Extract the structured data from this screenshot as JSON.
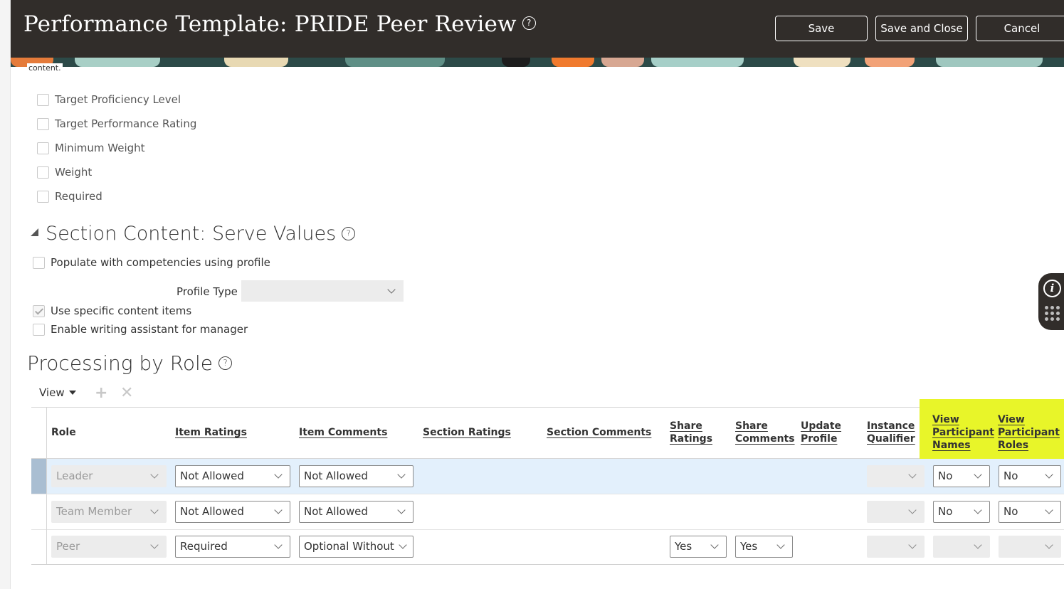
{
  "header": {
    "title": "Performance Template: PRIDE Peer Review",
    "help_icon": "question-circle-icon",
    "save_label": "Save",
    "save_close_label": "Save and Close",
    "cancel_label": "Cancel"
  },
  "fragment_text": "content.",
  "checkboxes": [
    {
      "label": "Target Proficiency Level",
      "checked": false
    },
    {
      "label": "Target Performance Rating",
      "checked": false
    },
    {
      "label": "Minimum Weight",
      "checked": false
    },
    {
      "label": "Weight",
      "checked": false
    },
    {
      "label": "Required",
      "checked": false
    }
  ],
  "serve_values": {
    "title": "Section Content: Serve Values",
    "populate_label": "Populate with competencies using profile",
    "profile_type_label": "Profile Type",
    "profile_type_value": "",
    "specific_items_label": "Use specific content items",
    "writing_assistant_label": "Enable writing assistant for manager"
  },
  "processing": {
    "title": "Processing by Role",
    "view_label": "View",
    "columns": {
      "role": "Role",
      "item_ratings": "Item Ratings",
      "item_comments": "Item Comments",
      "section_ratings": "Section Ratings",
      "section_comments": "Section Comments",
      "share_ratings_1": "Share",
      "share_ratings_2": "Ratings",
      "share_comments_1": "Share",
      "share_comments_2": "Comments",
      "update_profile_1": "Update",
      "update_profile_2": "Profile",
      "instance_qualifier_1": "Instance",
      "instance_qualifier_2": "Qualifier",
      "view_names_1": "View",
      "view_names_2": "Participant",
      "view_names_3": "Names",
      "view_roles_1": "View",
      "view_roles_2": "Participant",
      "view_roles_3": "Roles"
    },
    "highlight_color": "#e8f529",
    "rows": [
      {
        "role": "Leader",
        "item_ratings": "Not Allowed",
        "item_comments": "Not Allowed",
        "share_ratings": "",
        "share_comments": "",
        "instance_qualifier": "",
        "view_names": "No",
        "view_roles": "No"
      },
      {
        "role": "Team Member",
        "item_ratings": "Not Allowed",
        "item_comments": "Not Allowed",
        "share_ratings": "",
        "share_comments": "",
        "instance_qualifier": "",
        "view_names": "No",
        "view_roles": "No"
      },
      {
        "role": "Peer",
        "item_ratings": "Required",
        "item_comments": "Optional Without",
        "share_ratings": "Yes",
        "share_comments": "Yes",
        "instance_qualifier": "",
        "view_names": "",
        "view_roles": ""
      }
    ]
  },
  "side_widget": {
    "info_icon": "info-icon",
    "info_glyph": "i",
    "apps_icon": "grid-dots-icon"
  }
}
